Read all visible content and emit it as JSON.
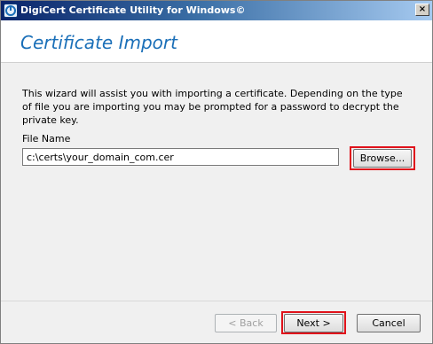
{
  "window": {
    "title": "DigiCert Certificate Utility for Windows©",
    "close_label": "×",
    "icon": "digicert-logo-icon"
  },
  "header": {
    "title": "Certificate Import"
  },
  "body": {
    "intro": "This wizard will assist you with importing a certificate.  Depending on the type of file you are importing you may be prompted for a password to decrypt the private key.",
    "file_name_label": "File Name",
    "file_name_value": "c:\\certs\\your_domain_com.cer",
    "browse_label": "Browse..."
  },
  "footer": {
    "back_label": "< Back",
    "next_label": "Next >",
    "cancel_label": "Cancel"
  },
  "colors": {
    "title_accent": "#1a6fb8",
    "highlight": "#e0121b"
  }
}
